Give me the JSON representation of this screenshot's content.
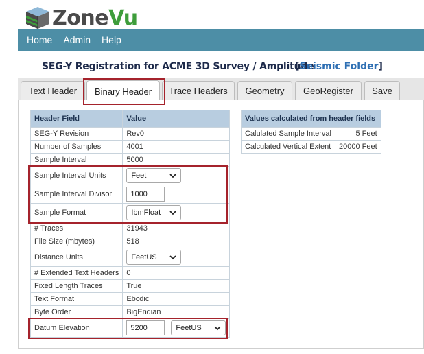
{
  "app": {
    "logo_zone": "Zone",
    "logo_vu": "Vu"
  },
  "nav": {
    "items": [
      "Home",
      "Admin",
      "Help"
    ]
  },
  "page": {
    "title": "SEG-Y Registration for ACME 3D Survey / Amplitude",
    "folder_open": "[",
    "folder_link": "Seismic Folder",
    "folder_close": "]"
  },
  "tabs": [
    "Text Header",
    "Binary Header",
    "Trace Headers",
    "Geometry",
    "GeoRegister",
    "Save"
  ],
  "active_tab": "Binary Header",
  "header_table": {
    "col_field": "Header Field",
    "col_value": "Value",
    "rows": [
      {
        "field": "SEG-Y Revision",
        "value": "Rev0"
      },
      {
        "field": "Number of Samples",
        "value": "4001"
      },
      {
        "field": "Sample Interval",
        "value": "5000"
      },
      {
        "field": "Sample Interval Units",
        "value": "Feet"
      },
      {
        "field": "Sample Interval Divisor",
        "value": "1000"
      },
      {
        "field": "Sample Format",
        "value": "IbmFloat"
      },
      {
        "field": "# Traces",
        "value": "31943"
      },
      {
        "field": "File Size (mbytes)",
        "value": "518"
      },
      {
        "field": "Distance Units",
        "value": "FeetUS"
      },
      {
        "field": "# Extended Text Headers",
        "value": "0"
      },
      {
        "field": "Fixed Length Traces",
        "value": "True"
      },
      {
        "field": "Text Format",
        "value": "Ebcdic"
      },
      {
        "field": "Byte Order",
        "value": "BigEndian"
      },
      {
        "field": "Datum Elevation",
        "value": "5200",
        "unit": "FeetUS"
      }
    ]
  },
  "calc_table": {
    "title": "Values calculated from header fields",
    "rows": [
      {
        "label": "Calulated Sample Interval",
        "value": "5 Feet"
      },
      {
        "label": "Calculated Vertical Extent",
        "value": "20000 Feet"
      }
    ]
  },
  "colors": {
    "navbar": "#4d8ea6",
    "highlight": "#a5232c",
    "table_header": "#b8cde0",
    "logo_green": "#3e9d3b"
  }
}
